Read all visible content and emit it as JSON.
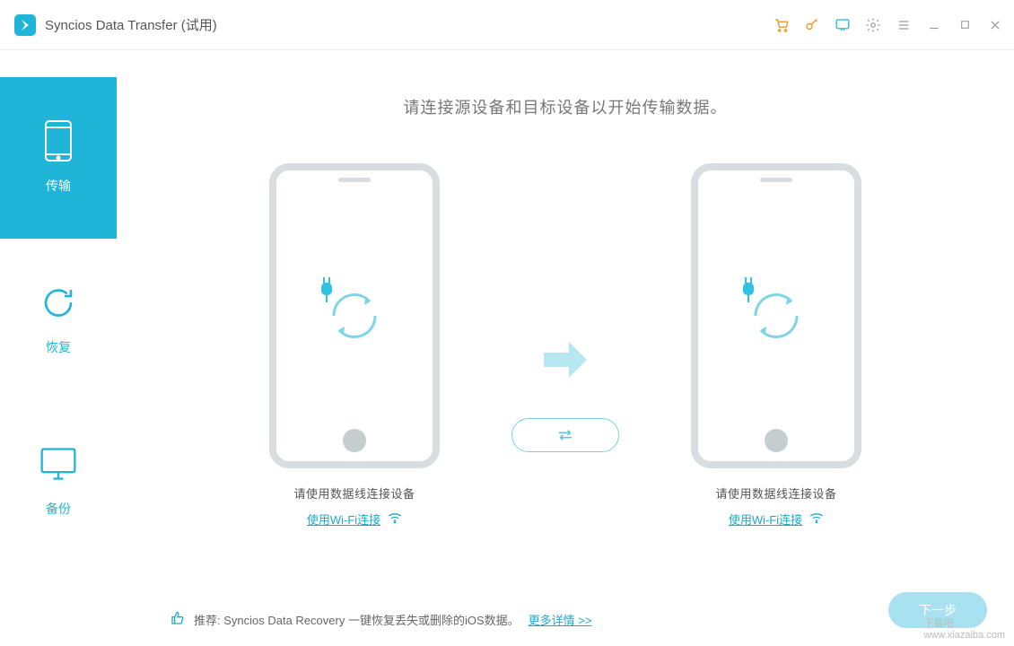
{
  "app": {
    "title": "Syncios Data Transfer (试用)"
  },
  "sidebar": {
    "items": [
      {
        "label": "传输"
      },
      {
        "label": "恢复"
      },
      {
        "label": "备份"
      }
    ]
  },
  "main": {
    "heading": "请连接源设备和目标设备以开始传输数据。",
    "source": {
      "caption": "请使用数据线连接设备",
      "wifi_label": "使用Wi-Fi连接"
    },
    "target": {
      "caption": "请使用数据线连接设备",
      "wifi_label": "使用Wi-Fi连接"
    },
    "next_label": "下一步"
  },
  "footer": {
    "promo_text": "推荐: Syncios Data Recovery 一键恢复丢失或删除的iOS数据。",
    "more_link": "更多详情 >>"
  },
  "watermark": {
    "line1": "下载吧",
    "line2": "www.xiazaiba.com"
  }
}
